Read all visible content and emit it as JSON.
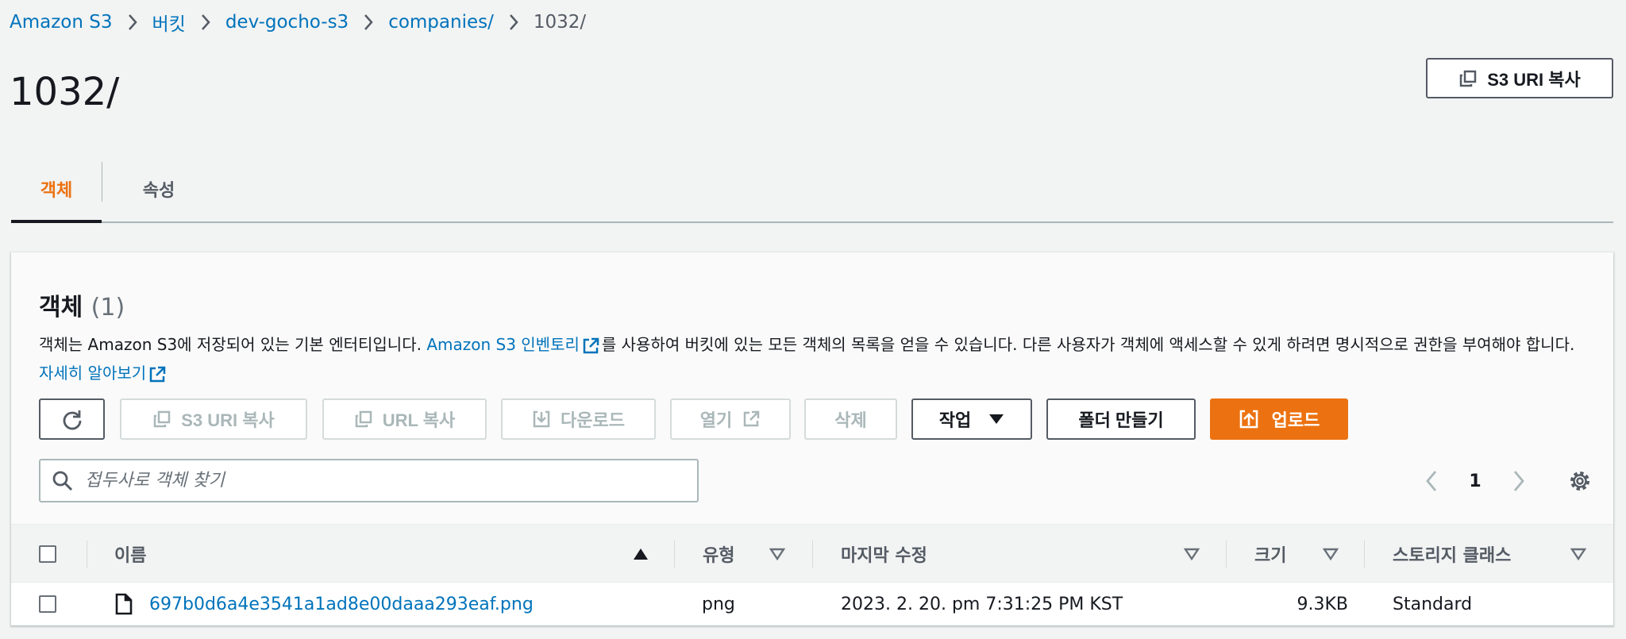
{
  "breadcrumb": {
    "items": [
      "Amazon S3",
      "버킷",
      "dev-gocho-s3",
      "companies/",
      "1032/"
    ]
  },
  "page": {
    "title": "1032/",
    "copy_uri_label": "S3 URI 복사"
  },
  "tabs": [
    {
      "label": "객체",
      "active": true
    },
    {
      "label": "속성",
      "active": false
    }
  ],
  "objects": {
    "title": "객체",
    "count": "(1)",
    "description": {
      "part1": "객체는 Amazon S3에 저장되어 있는 기본 엔터티입니다. ",
      "inventory_link": "Amazon S3 인벤토리",
      "part2": "를 사용하여 버킷에 있는 모든 객체의 목록을 얻을 수 있습니다. 다른 사용자가 객체에 액세스할 수 있게 하려면 명시적으로 권한을 부여해야 합니다. ",
      "learn_more_link": "자세히 알아보기"
    },
    "toolbar": {
      "copy_s3_uri": "S3 URI 복사",
      "copy_url": "URL 복사",
      "download": "다운로드",
      "open": "열기",
      "delete": "삭제",
      "actions": "작업",
      "create_folder": "폴더 만들기",
      "upload": "업로드"
    },
    "search": {
      "placeholder": "접두사로 객체 찾기",
      "value": ""
    },
    "pagination": {
      "current_page": "1"
    },
    "table": {
      "columns": [
        "이름",
        "유형",
        "마지막 수정",
        "크기",
        "스토리지 클래스"
      ],
      "rows": [
        {
          "name": "697b0d6a4e3541a1ad8e00daaa293eaf.png",
          "type": "png",
          "last_modified": "2023. 2. 20. pm 7:31:25 PM KST",
          "size": "9.3KB",
          "storage_class": "Standard"
        }
      ]
    }
  },
  "colors": {
    "link": "#0073bb",
    "accent": "#ec7211",
    "text": "#16191f",
    "muted": "#545b64",
    "disabled": "#aab7b8"
  },
  "icons": [
    "chevron-right-icon",
    "copy-icon",
    "refresh-icon",
    "download-icon",
    "external-link-icon",
    "caret-down-icon",
    "upload-icon",
    "search-icon",
    "chevron-left-icon",
    "gear-icon",
    "sort-ascending-icon",
    "sort-icon",
    "file-icon"
  ]
}
